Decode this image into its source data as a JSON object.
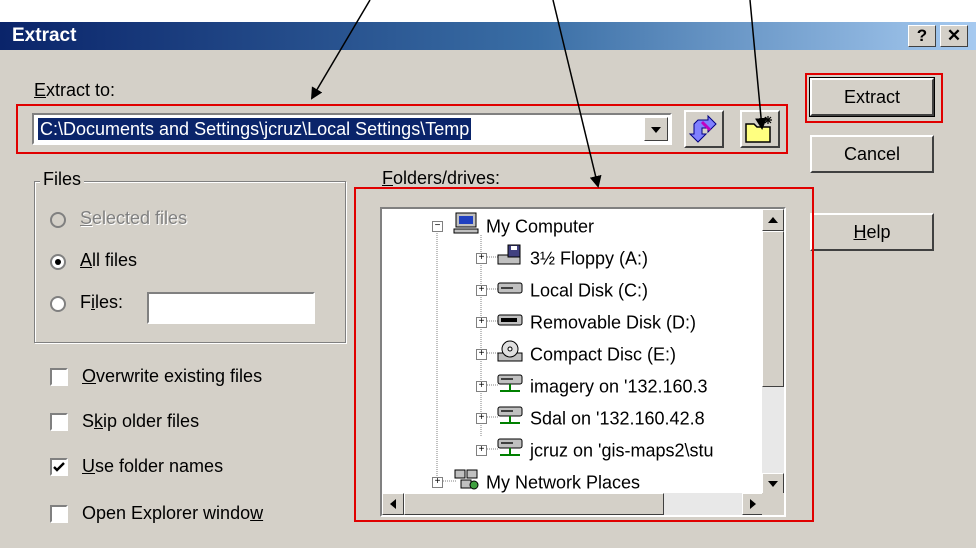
{
  "window": {
    "title": "Extract",
    "help_label": "?",
    "close_label": "✕"
  },
  "extract_to": {
    "label": "Extract to:",
    "path": "C:\\Documents and Settings\\jcruz\\Local Settings\\Temp"
  },
  "buttons": {
    "extract": "Extract",
    "cancel": "Cancel",
    "help": "Help"
  },
  "files_group": {
    "title": "Files",
    "selected_files": "Selected files",
    "all_files": "All files",
    "files": "Files:",
    "files_value": ""
  },
  "options": {
    "overwrite": "Overwrite existing files",
    "skip_older": "Skip older files",
    "use_folder_names": "Use folder names",
    "open_explorer": "Open Explorer window"
  },
  "folders": {
    "label": "Folders/drives:",
    "items": [
      {
        "label": "My Computer",
        "icon": "computer-icon"
      },
      {
        "label": "3½ Floppy (A:)",
        "icon": "floppy-drive-icon"
      },
      {
        "label": "Local Disk (C:)",
        "icon": "hard-disk-icon"
      },
      {
        "label": "Removable Disk (D:)",
        "icon": "removable-disk-icon"
      },
      {
        "label": "Compact Disc (E:)",
        "icon": "cd-drive-icon"
      },
      {
        "label": "imagery on '132.160.3",
        "icon": "network-drive-icon"
      },
      {
        "label": "Sdal on '132.160.42.8",
        "icon": "network-drive-icon"
      },
      {
        "label": "jcruz on 'gis-maps2\\stu",
        "icon": "network-drive-icon"
      },
      {
        "label": "My Network Places",
        "icon": "network-places-icon"
      }
    ]
  },
  "colors": {
    "title_start": "#0a246a",
    "title_end": "#a6caf0",
    "annotation": "#e00000",
    "dialog_bg": "#d4d0c8"
  }
}
